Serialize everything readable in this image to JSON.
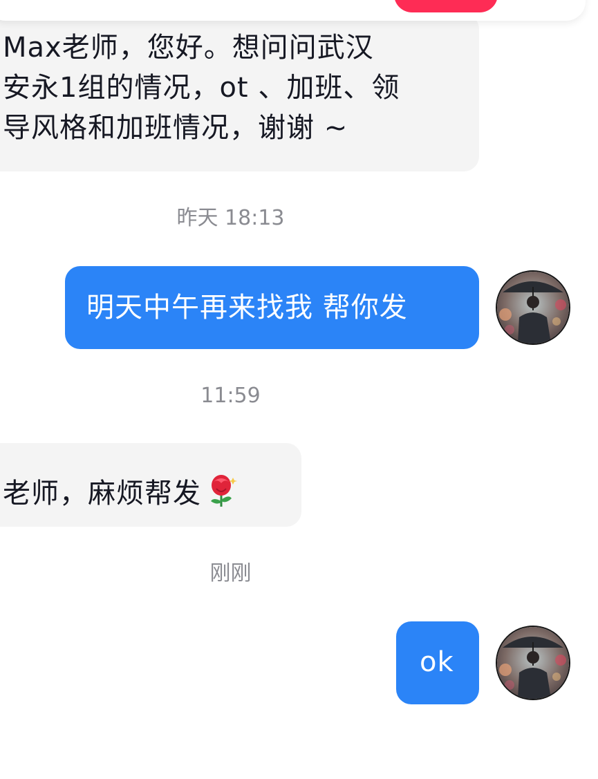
{
  "messages": [
    {
      "direction": "incoming",
      "lines": [
        "Max老师，您好。想问问武汉",
        "安永1组的情况，ot 、加班、领",
        "导风格和加班情况，谢谢 ~"
      ]
    },
    {
      "timestamp": "昨天 18:13"
    },
    {
      "direction": "outgoing",
      "text": "明天中午再来找我 帮你发"
    },
    {
      "timestamp": "11:59"
    },
    {
      "direction": "incoming",
      "text": "老师，麻烦帮发",
      "emoji": "rose-icon"
    },
    {
      "timestamp": "刚刚"
    },
    {
      "direction": "outgoing",
      "text": "ok"
    }
  ],
  "colors": {
    "outgoing_bubble": "#2b84f7",
    "incoming_bubble": "#f4f4f4",
    "timestamp_text": "#8a8b91",
    "accent_red": "#fe2c55"
  }
}
